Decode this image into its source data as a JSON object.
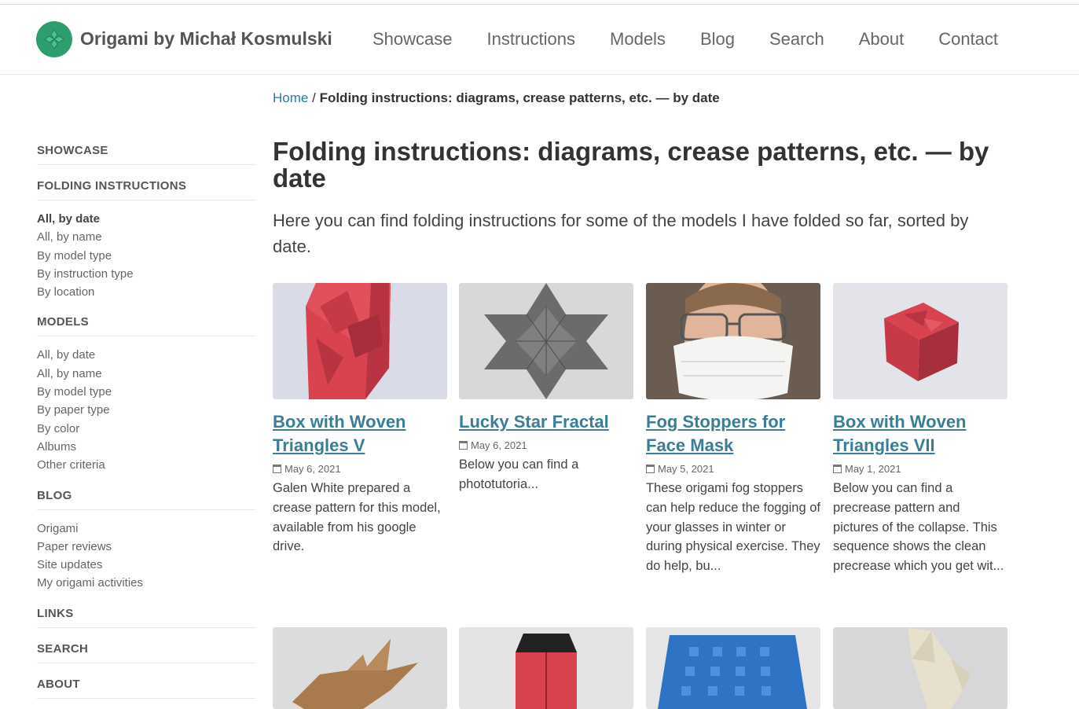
{
  "header": {
    "site_title": "Origami by Michał Kosmulski",
    "nav": [
      "Showcase",
      "Instructions",
      "Models",
      "Blog",
      "Search",
      "About",
      "Contact"
    ]
  },
  "breadcrumb": {
    "home": "Home",
    "separator": "/",
    "current": "Folding instructions: diagrams, crease patterns, etc. — by date"
  },
  "sidebar": {
    "showcase": "SHOWCASE",
    "folding_instructions": {
      "heading": "FOLDING INSTRUCTIONS",
      "items": [
        "All, by date",
        "All, by name",
        "By model type",
        "By instruction type",
        "By location"
      ]
    },
    "models": {
      "heading": "MODELS",
      "items": [
        "All, by date",
        "All, by name",
        "By model type",
        "By paper type",
        "By color",
        "Albums",
        "Other criteria"
      ]
    },
    "blog": {
      "heading": "BLOG",
      "items": [
        "Origami",
        "Paper reviews",
        "Site updates",
        "My origami activities"
      ]
    },
    "links": "LINKS",
    "search": "SEARCH",
    "about": "ABOUT"
  },
  "main": {
    "title": "Folding instructions: diagrams, crease patterns, etc. — by date",
    "intro": "Here you can find folding instructions for some of the models I have folded so far, sorted by date.",
    "cards": [
      {
        "title": "Box with Woven Triangles V",
        "date": "May 6, 2021",
        "text": "Galen White prepared a crease pattern for this model, available from his google drive."
      },
      {
        "title": "Lucky Star Fractal",
        "date": "May 6, 2021",
        "text": "Below you can find a phototutoria..."
      },
      {
        "title": "Fog Stoppers for Face Mask",
        "date": "May 5, 2021",
        "text": "These origami fog stoppers can help reduce the fogging of your glasses in winter or during physical exercise. They do help, bu..."
      },
      {
        "title": "Box with Woven Triangles VII",
        "date": "May 1, 2021",
        "text": "Below you can find a precrease pattern and pictures of the collapse. This sequence shows the clean precrease which you get wit..."
      }
    ]
  },
  "colors": {
    "link": "#2a7aa8",
    "card_title": "#3a7d96",
    "logo": "#2e9e6e"
  }
}
